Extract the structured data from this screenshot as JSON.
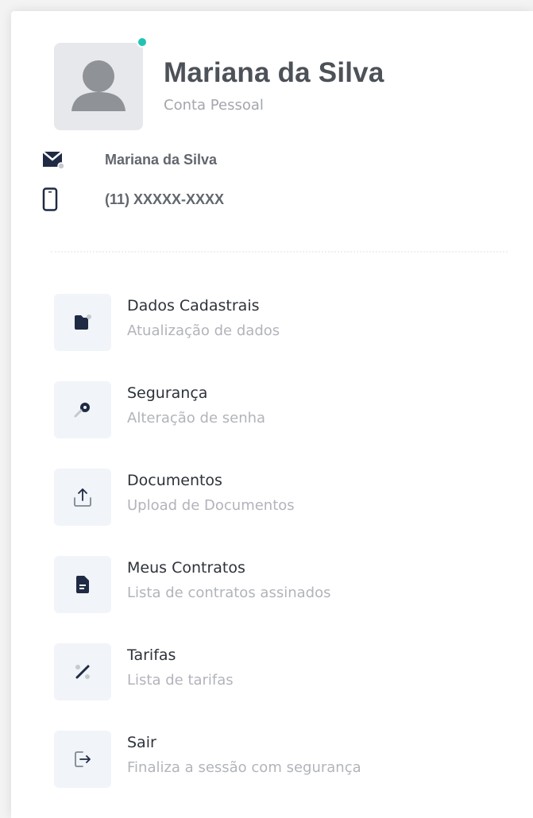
{
  "profile": {
    "name": "Mariana da Silva",
    "account_type": "Conta Pessoal",
    "status_color": "#20c4b2",
    "avatar_icon": "user-silhouette-icon"
  },
  "contact": {
    "email_icon": "envelope-icon",
    "email_text": "Mariana da Silva",
    "phone_icon": "smartphone-icon",
    "phone_text": "(11) XXXXX-XXXX"
  },
  "menu": {
    "items": [
      {
        "title": "Dados Cadastrais",
        "subtitle": "Atualização de dados",
        "icon": "folder-icon"
      },
      {
        "title": "Segurança",
        "subtitle": "Alteração de senha",
        "icon": "key-icon"
      },
      {
        "title": "Documentos",
        "subtitle": "Upload de Documentos",
        "icon": "upload-icon"
      },
      {
        "title": "Meus Contratos",
        "subtitle": "Lista de contratos assinados",
        "icon": "document-icon"
      },
      {
        "title": "Tarifas",
        "subtitle": "Lista de tarifas",
        "icon": "percent-icon"
      },
      {
        "title": "Sair",
        "subtitle": "Finaliza a sessão com segurança",
        "icon": "logout-icon"
      }
    ]
  },
  "colors": {
    "accent_dark": "#1f2a44",
    "tile_bg": "#f1f4f8",
    "muted_text": "#b1b4ba"
  }
}
